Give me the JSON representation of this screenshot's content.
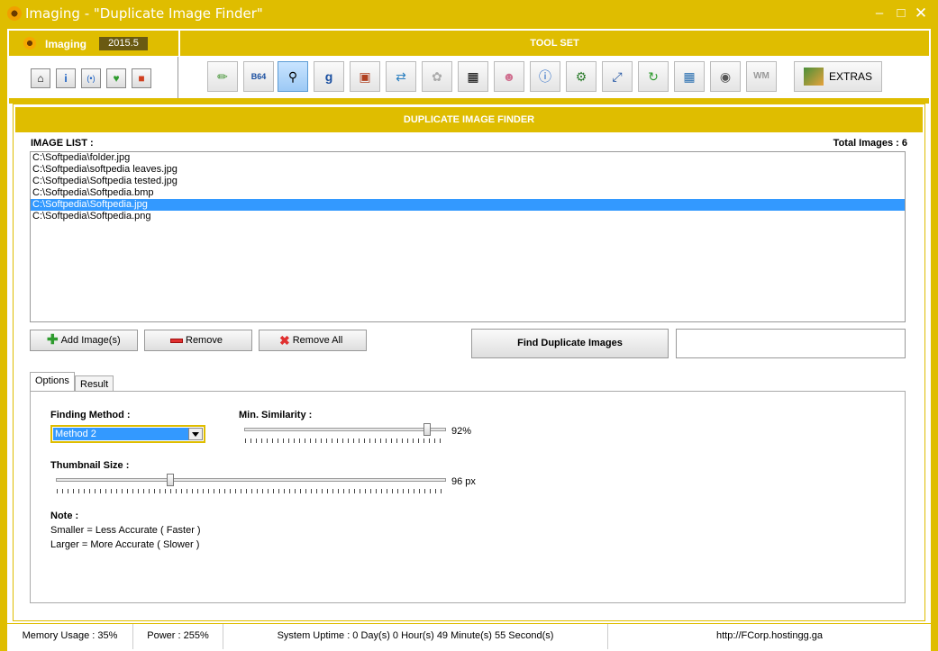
{
  "window": {
    "title": "Imaging - \"Duplicate Image Finder\""
  },
  "brand": {
    "name": "Imaging",
    "version": "2015.5"
  },
  "toolset": {
    "title": "TOOL SET",
    "extras_label": "EXTRAS",
    "b64_label": "B64",
    "google_label": "g",
    "wm_label": "WM"
  },
  "panel": {
    "title": "DUPLICATE IMAGE FINDER",
    "image_list_label": "IMAGE LIST :",
    "total_images": "Total Images : 6",
    "images": [
      "C:\\Softpedia\\folder.jpg",
      "C:\\Softpedia\\softpedia leaves.jpg",
      "C:\\Softpedia\\Softpedia tested.jpg",
      "C:\\Softpedia\\Softpedia.bmp",
      "C:\\Softpedia\\Softpedia.jpg",
      "C:\\Softpedia\\Softpedia.png"
    ],
    "selected_index": 4,
    "add_label": "Add Image(s)",
    "remove_label": "Remove",
    "remove_all_label": "Remove All",
    "find_label": "Find Duplicate Images"
  },
  "tabs": {
    "options": "Options",
    "result": "Result"
  },
  "options": {
    "finding_method_label": "Finding Method :",
    "finding_method_value": "Method 2",
    "similarity_label": "Min. Similarity :",
    "similarity_value": "92%",
    "similarity_fraction": 0.92,
    "thumbnail_label": "Thumbnail Size :",
    "thumbnail_value": "96 px",
    "thumbnail_fraction": 0.29,
    "note_title": "Note :",
    "note_line1": "Smaller = Less Accurate ( Faster )",
    "note_line2": "Larger = More Accurate ( Slower )"
  },
  "status": {
    "memory": "Memory Usage : 35%",
    "power": "Power : 255%",
    "uptime": "System Uptime : 0 Day(s) 0 Hour(s) 49 Minute(s) 55 Second(s)",
    "url": "http://FCorp.hostingg.ga"
  },
  "colors": {
    "accent": "#dfbd00",
    "selection": "#3399ff"
  }
}
